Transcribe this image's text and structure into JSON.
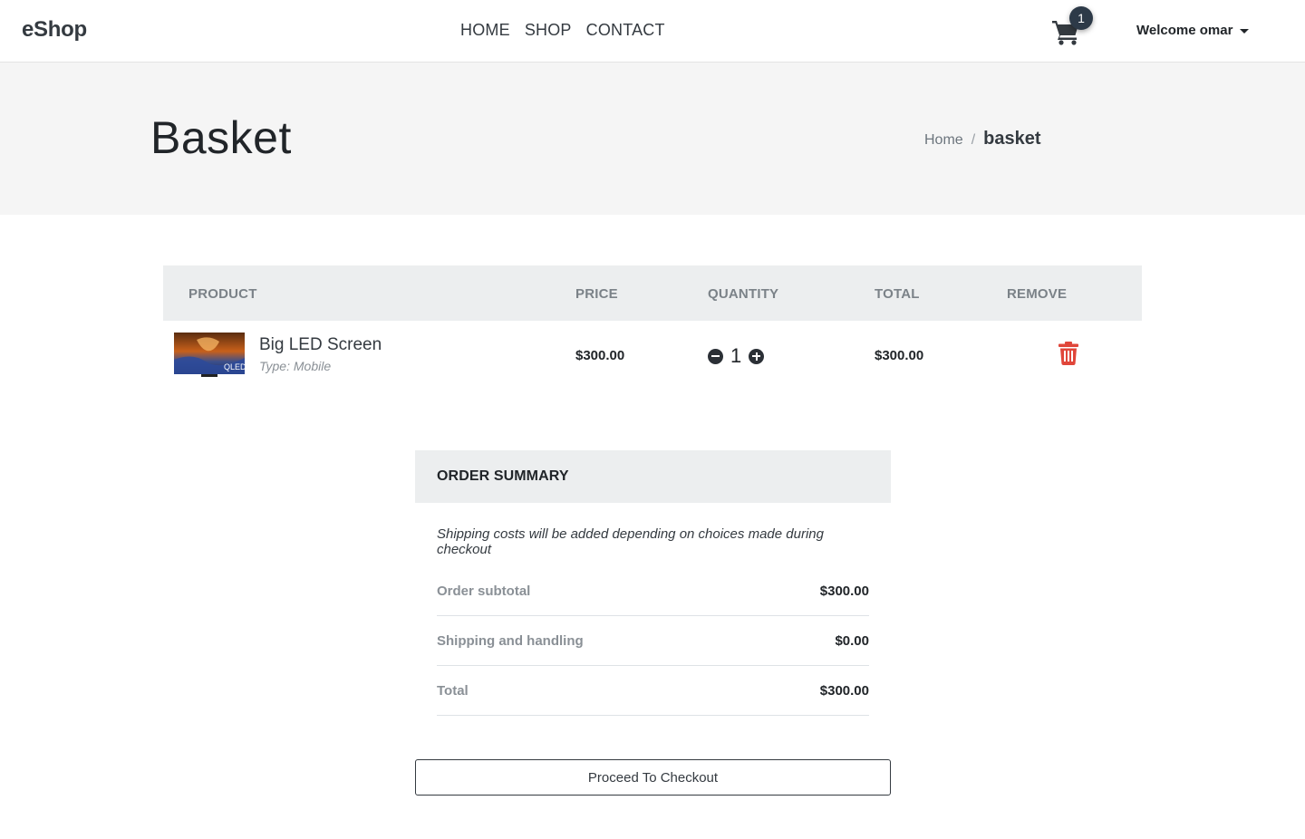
{
  "navbar": {
    "brand": "eShop",
    "links": [
      "HOME",
      "SHOP",
      "CONTACT"
    ],
    "cart_count": "1",
    "welcome": "Welcome omar"
  },
  "hero": {
    "title": "Basket",
    "breadcrumb": {
      "home": "Home",
      "separator": "/",
      "current": "basket"
    }
  },
  "basket": {
    "headers": {
      "product": "PRODUCT",
      "price": "PRICE",
      "quantity": "QUANTITY",
      "total": "TOTAL",
      "remove": "REMOVE"
    },
    "items": [
      {
        "name": "Big LED Screen",
        "type": "Type: Mobile",
        "image_icon": "tv-product-image",
        "image_label": "QLED",
        "price": "$300.00",
        "quantity": "1",
        "total": "$300.00"
      }
    ]
  },
  "summary": {
    "title": "ORDER SUMMARY",
    "note": "Shipping costs will be added depending on choices made during checkout",
    "rows": [
      {
        "label": "Order subtotal",
        "value": "$300.00"
      },
      {
        "label": "Shipping and handling",
        "value": "$0.00"
      },
      {
        "label": "Total",
        "value": "$300.00"
      }
    ]
  },
  "checkout_label": "Proceed To Checkout",
  "colors": {
    "trash": "#e0463a",
    "badge": "#2d3a48",
    "header_bg": "#eceeef",
    "hero_bg": "#f5f5f5"
  }
}
